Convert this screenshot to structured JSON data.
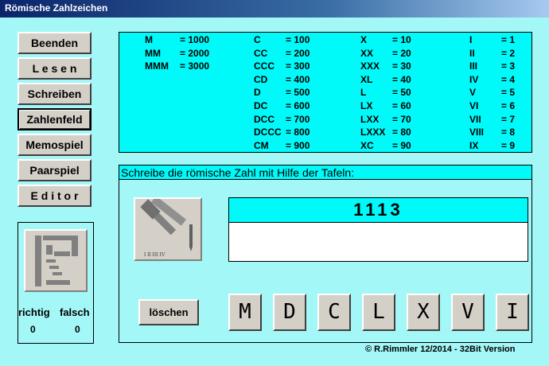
{
  "window": {
    "title": "Römische Zahlzeichen"
  },
  "menu": [
    {
      "label": "Beenden",
      "selected": false
    },
    {
      "label": "L e s e n",
      "selected": false
    },
    {
      "label": "Schreiben",
      "selected": false
    },
    {
      "label": "Zahlenfeld",
      "selected": true
    },
    {
      "label": "Memospiel",
      "selected": false
    },
    {
      "label": "Paarspiel",
      "selected": false
    },
    {
      "label": "E d i t o r",
      "selected": false
    }
  ],
  "table": {
    "col1": [
      [
        "M",
        "= 1000"
      ],
      [
        "MM",
        "= 2000"
      ],
      [
        "MMM",
        "= 3000"
      ]
    ],
    "col2": [
      [
        "C",
        "= 100"
      ],
      [
        "CC",
        "= 200"
      ],
      [
        "CCC",
        "= 300"
      ],
      [
        "CD",
        "= 400"
      ],
      [
        "D",
        "= 500"
      ],
      [
        "DC",
        "= 600"
      ],
      [
        "DCC",
        "= 700"
      ],
      [
        "DCCC",
        "= 800"
      ],
      [
        "CM",
        "= 900"
      ]
    ],
    "col3": [
      [
        "X",
        "= 10"
      ],
      [
        "XX",
        "= 20"
      ],
      [
        "XXX",
        "= 30"
      ],
      [
        "XL",
        "= 40"
      ],
      [
        "L",
        "= 50"
      ],
      [
        "LX",
        "= 60"
      ],
      [
        "LXX",
        "= 70"
      ],
      [
        "LXXX",
        "= 80"
      ],
      [
        "XC",
        "= 90"
      ]
    ],
    "col4": [
      [
        "I",
        "= 1"
      ],
      [
        "II",
        "= 2"
      ],
      [
        "III",
        "= 3"
      ],
      [
        "IV",
        "= 4"
      ],
      [
        "V",
        "= 5"
      ],
      [
        "VI",
        "= 6"
      ],
      [
        "VII",
        "= 7"
      ],
      [
        "VIII",
        "= 8"
      ],
      [
        "IX",
        "= 9"
      ]
    ]
  },
  "task": {
    "instruction": "Schreibe die römische Zahl mit Hilfe der Tafeln:",
    "number": "1113",
    "answer": "",
    "hammer_caption": "I II III IV",
    "clear_label": "löschen",
    "numerals": [
      "M",
      "D",
      "C",
      "L",
      "X",
      "V",
      "I"
    ]
  },
  "score": {
    "correct_label": "richtig",
    "wrong_label": "falsch",
    "correct": "0",
    "wrong": "0"
  },
  "copyright": "© R.Rimmler 12/2014 - 32Bit Version",
  "colors": {
    "background": "#a3f7f7",
    "table": "#00fafa",
    "titlebar": "#0a246a"
  },
  "icons": {
    "task_icon": "hammer-chisel-icon",
    "score_icon": "memo-icon"
  }
}
